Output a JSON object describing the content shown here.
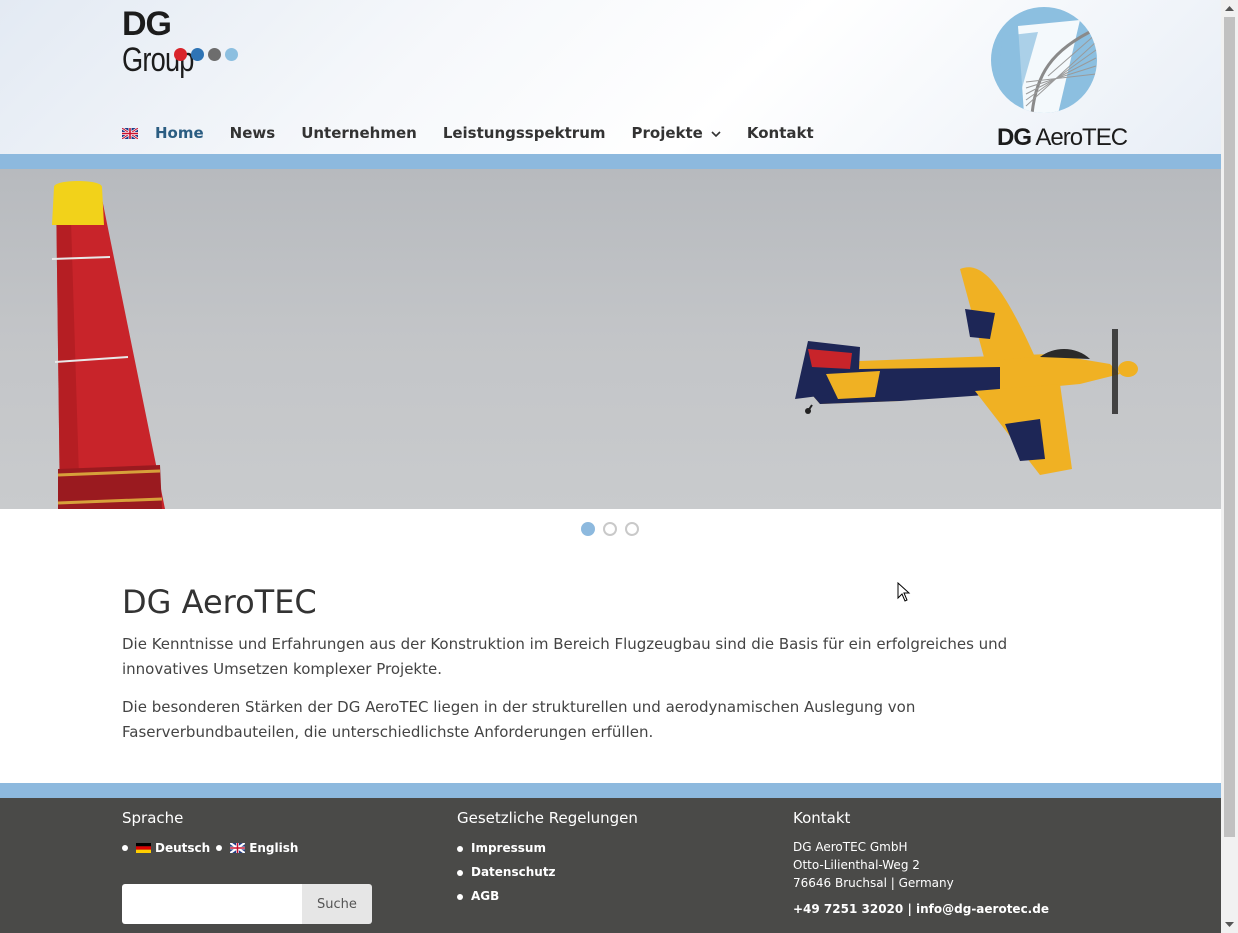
{
  "header": {
    "logo_group": {
      "strong": "DG",
      "light": "Group",
      "dot_colors": [
        "#d9242b",
        "#2e74b5",
        "#6d6d6d",
        "#8cbfe0"
      ]
    },
    "nav": {
      "items": [
        {
          "label": "Home",
          "active": true
        },
        {
          "label": "News"
        },
        {
          "label": "Unternehmen"
        },
        {
          "label": "Leistungsspektrum"
        },
        {
          "label": "Projekte",
          "has_dropdown": true
        },
        {
          "label": "Kontakt"
        }
      ]
    },
    "logo_aerotec": {
      "strong": "DG",
      "light": "AeroTEC"
    }
  },
  "slider": {
    "dot_count": 3,
    "active_index": 0
  },
  "main": {
    "title": "DG AeroTEC",
    "paragraphs": [
      "Die Kenntnisse und Erfahrungen aus der Konstruktion im Bereich Flugzeugbau sind die Basis für ein erfolgreiches und innovatives Umsetzen komplexer Projekte.",
      "Die besonderen  Stärken der DG AeroTEC liegen in der strukturellen und aerodynamischen Auslegung von Faserverbundbauteilen, die unterschiedlichste Anforderungen erfüllen."
    ]
  },
  "footer": {
    "sprache": {
      "heading": "Sprache",
      "languages": [
        "Deutsch",
        "English"
      ],
      "search_button": "Suche",
      "search_placeholder": ""
    },
    "legal": {
      "heading": "Gesetzliche Regelungen",
      "links": [
        "Impressum",
        "Datenschutz",
        "AGB"
      ]
    },
    "kontakt": {
      "heading": "Kontakt",
      "company": "DG AeroTEC GmbH",
      "street": "Otto-Lilienthal-Weg 2",
      "city": "76646 Bruchsal | Germany",
      "phone": "+49 7251 32020",
      "separator": " | ",
      "email": "info@dg-aerotec.de"
    }
  },
  "colors": {
    "accent_blue": "#8db9de",
    "nav_active": "#2b5d82",
    "footer_bg": "#4a4a48"
  }
}
